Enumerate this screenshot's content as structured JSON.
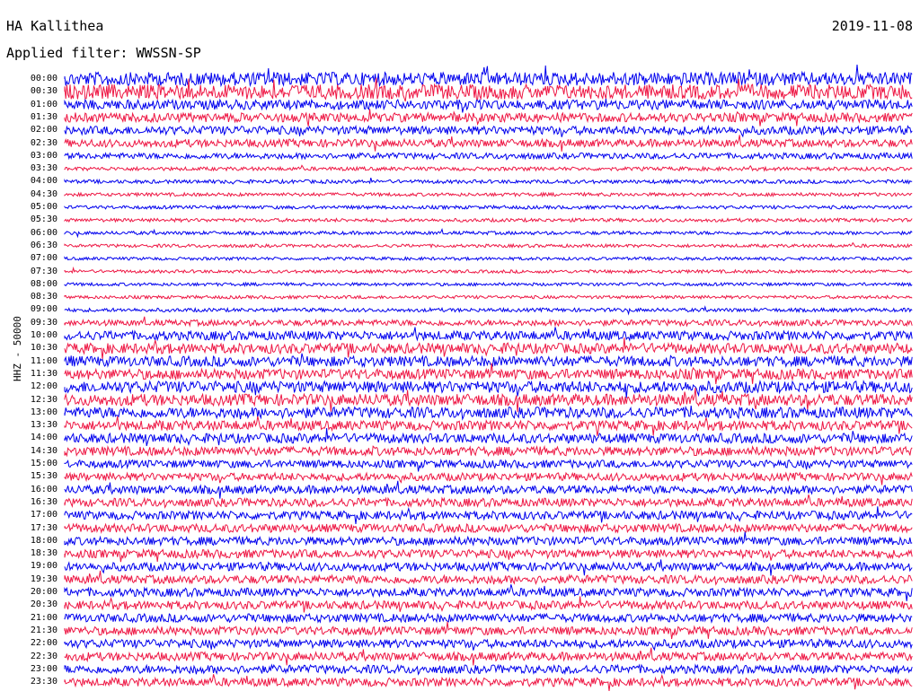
{
  "header": {
    "station": "HA Kallithea",
    "filter": "Applied filter: WWSSN-SP",
    "date": "2019-11-08"
  },
  "channel_label": "HHZ - 50000",
  "colors": {
    "even_row": "#0000ee",
    "odd_row": "#ee1744",
    "text": "#000000",
    "background": "#ffffff"
  },
  "time_labels": [
    "00:00",
    "00:30",
    "01:00",
    "01:30",
    "02:00",
    "02:30",
    "03:00",
    "03:30",
    "04:00",
    "04:30",
    "05:00",
    "05:30",
    "06:00",
    "06:30",
    "07:00",
    "07:30",
    "08:00",
    "08:30",
    "09:00",
    "09:30",
    "10:00",
    "10:30",
    "11:00",
    "11:30",
    "12:00",
    "12:30",
    "13:00",
    "13:30",
    "14:00",
    "14:30",
    "15:00",
    "15:30",
    "16:00",
    "16:30",
    "17:00",
    "17:30",
    "18:00",
    "18:30",
    "19:00",
    "19:30",
    "20:00",
    "20:30",
    "21:00",
    "21:30",
    "22:00",
    "22:30",
    "23:00",
    "23:30"
  ],
  "row_noise_level": [
    0.9,
    1.0,
    0.6,
    0.55,
    0.5,
    0.45,
    0.3,
    0.12,
    0.12,
    0.1,
    0.1,
    0.1,
    0.1,
    0.08,
    0.07,
    0.08,
    0.08,
    0.08,
    0.12,
    0.3,
    0.55,
    0.65,
    0.65,
    0.65,
    0.75,
    0.75,
    0.7,
    0.6,
    0.6,
    0.55,
    0.45,
    0.45,
    0.5,
    0.5,
    0.5,
    0.5,
    0.5,
    0.5,
    0.5,
    0.5,
    0.5,
    0.5,
    0.5,
    0.5,
    0.5,
    0.5,
    0.5,
    0.5
  ]
}
